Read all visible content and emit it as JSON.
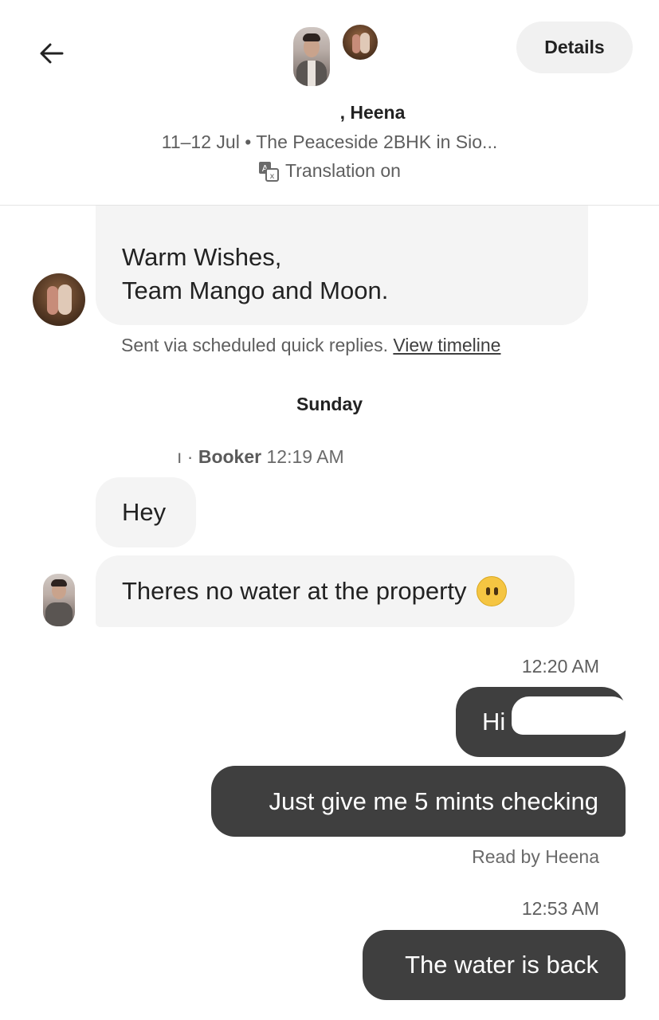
{
  "header": {
    "back_label": "",
    "details_label": "Details",
    "title": "Heena",
    "title_prefix": ",",
    "subtitle": "11–12 Jul • The Peaceside 2BHK in Sio...",
    "translation": "Translation on"
  },
  "messages": {
    "m1": {
      "line1": "Warm Wishes,",
      "line2": "Team Mango and Moon."
    },
    "sent_via": "Sent via scheduled quick replies.",
    "view_timeline": "View timeline",
    "day": "Sunday",
    "sender_sep": "ı ·",
    "sender_role": "Booker",
    "sender_time": "12:19 AM",
    "m2": "Hey",
    "m3": "Theres no water at the property",
    "time_out1": "12:20 AM",
    "o1": "Hi",
    "o2": "Just give me 5 mints checking",
    "read": "Read by Heena",
    "time_out2": "12:53 AM",
    "o3": "The water is back"
  },
  "colors": {
    "outgoing_bubble": "#3f3f3f",
    "incoming_bubble": "#f4f4f4",
    "muted_text": "#5e5e5e"
  },
  "icons": [
    "back-arrow-icon",
    "translate-icon",
    "neutral-face-emoji"
  ]
}
